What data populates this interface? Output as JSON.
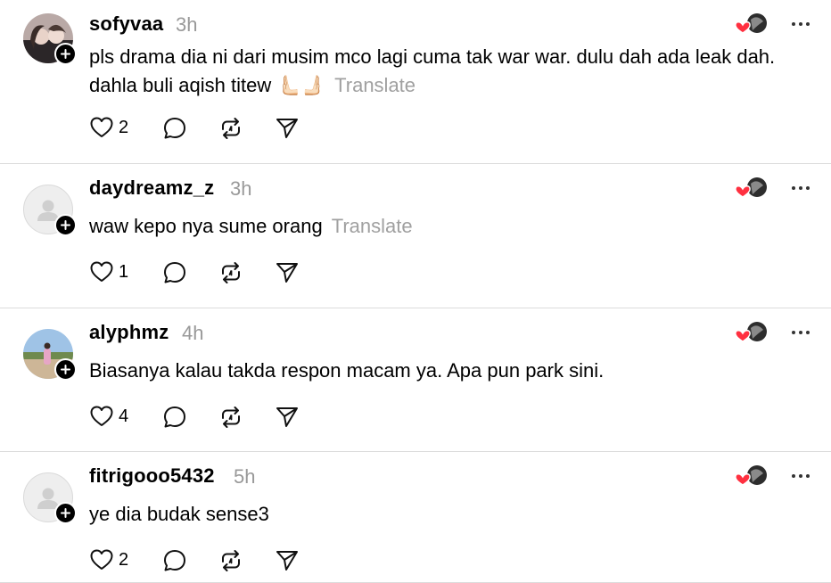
{
  "posts": [
    {
      "username": "sofyvaa",
      "time": "3h",
      "text_line1": "pls drama dia ni dari musim mco lagi cuma tak war war. dulu dah ada leak dah.",
      "text_line2": "dahla buli aqish titew 🫷🏻🫸🏻",
      "translate_label": "Translate",
      "like_count": "2",
      "avatar": "photo"
    },
    {
      "username": "daydreamz_z",
      "time": "3h",
      "text_line1": "waw kepo nya sume orang",
      "text_line2": "",
      "translate_label": "Translate",
      "like_count": "1",
      "avatar": "default"
    },
    {
      "username": "alyphmz",
      "time": "4h",
      "text_line1": "Biasanya kalau takda respon macam ya. Apa pun park sini.",
      "text_line2": "",
      "translate_label": "",
      "like_count": "4",
      "avatar": "photo"
    },
    {
      "username": "fitrigooo5432",
      "time": "5h",
      "text_line1": "ye dia budak sense3",
      "text_line2": "",
      "translate_label": "",
      "like_count": "2",
      "avatar": "default"
    }
  ],
  "icons": {
    "like": "heart-icon",
    "reply": "comment-icon",
    "repost": "repost-icon",
    "share": "send-icon",
    "more": "more-horizontal-icon",
    "follow": "plus-icon",
    "reaction": "liked-by-author-icon"
  },
  "colors": {
    "heart_red": "#ff3040",
    "muted": "#999999",
    "divider": "#dcdcdc"
  }
}
